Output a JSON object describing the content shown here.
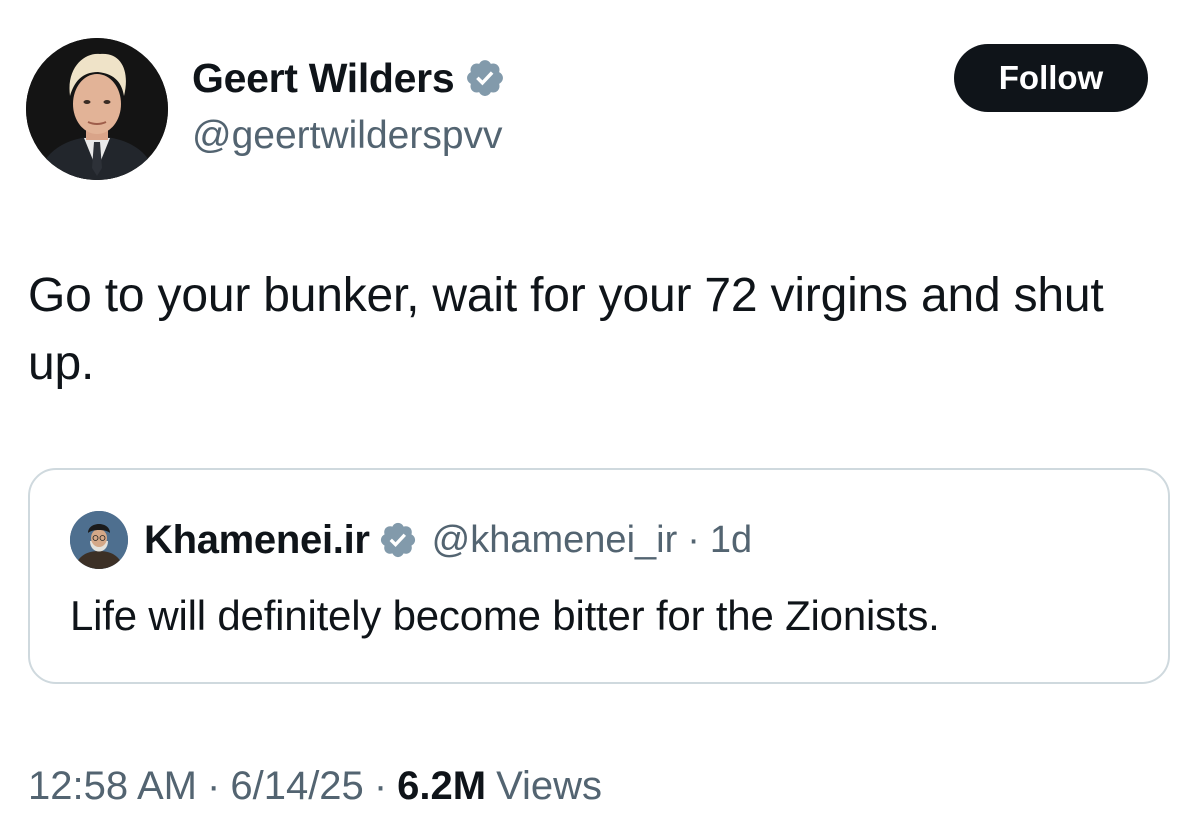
{
  "tweet": {
    "author": {
      "name": "Geert Wilders",
      "handle": "@geertwilderspvv",
      "avatar_icon": "profile-photo-man-blond-hair-suit",
      "verified_icon": "verified-badge-icon"
    },
    "follow_label": "Follow",
    "text": "Go to your bunker, wait for your 72 virgins and shut up.",
    "quoted": {
      "name": "Khamenei.ir",
      "handle": "@khamenei_ir",
      "separator": "·",
      "time": "1d",
      "text": "Life will definitely become bitter for the Zionists.",
      "avatar_icon": "profile-photo-elderly-man-turban",
      "verified_icon": "verified-badge-icon"
    },
    "meta": {
      "time": "12:58 AM",
      "separator": "·",
      "date": "6/14/25",
      "views_count": "6.2M",
      "views_label": "Views"
    }
  },
  "colors": {
    "text_primary": "#0f1419",
    "text_secondary": "#536471",
    "border": "#cfd9de",
    "follow_bg": "#0f1419",
    "follow_text": "#ffffff",
    "verified_badge": "#829aab"
  }
}
